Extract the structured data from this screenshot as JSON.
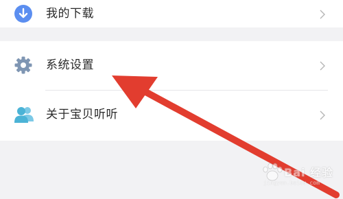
{
  "menu": {
    "items": [
      {
        "label": "我的下载",
        "icon": "download-icon",
        "icon_color": "#5b8ef0"
      },
      {
        "label": "系统设置",
        "icon": "gear-icon",
        "icon_color": "#7f96b3"
      },
      {
        "label": "关于宝贝听听",
        "icon": "users-icon",
        "icon_color": "#4bb3d6"
      }
    ],
    "chevron_icon": "chevron-right-icon"
  },
  "annotation": {
    "icon": "red-arrow-icon",
    "color": "#e23d2f"
  },
  "watermark": {
    "text": "Bai 经验",
    "url": "jingyan.baidu.com"
  }
}
